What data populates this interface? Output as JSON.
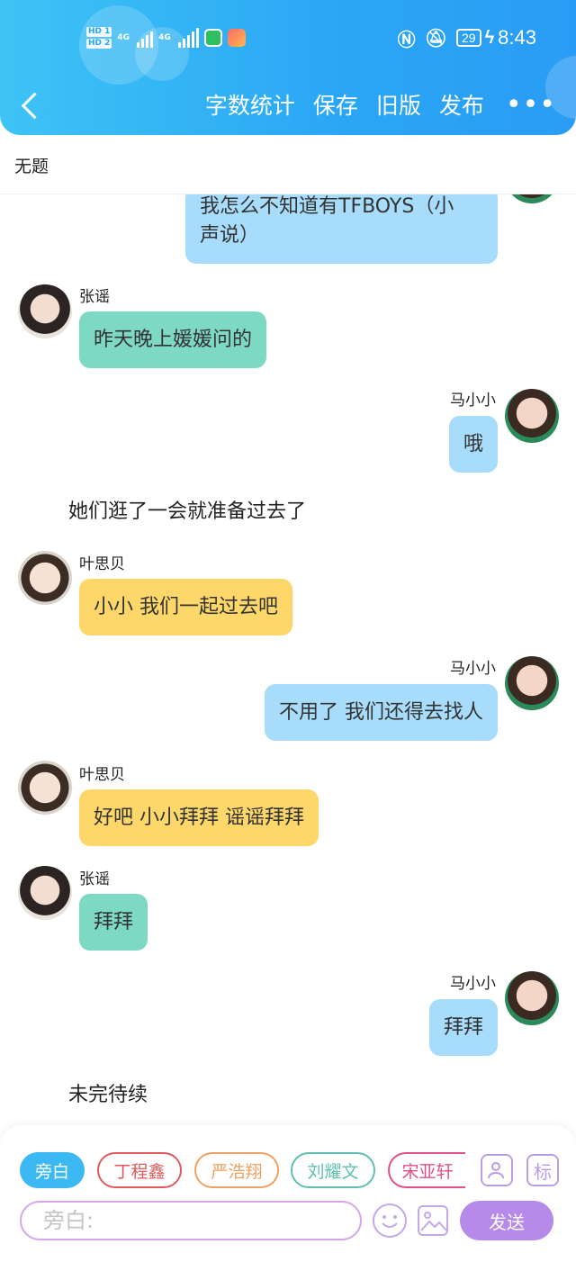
{
  "status_bar": {
    "hd1": "HD 1",
    "hd2": "HD 2",
    "net1": "4G",
    "net2": "4G",
    "battery": "29",
    "time": "8:43",
    "icons": [
      "nfc-icon",
      "mute-bell-icon",
      "charging-bolt-icon"
    ]
  },
  "nav": {
    "back_icon": "chevron-left-icon",
    "word_count": "字数统计",
    "save": "保存",
    "old_version": "旧版",
    "publish": "发布",
    "more": "•••"
  },
  "doc_title": "无题",
  "characters": {
    "zhangyao": {
      "name": "张谣",
      "bubble_color": "#7dd8c4"
    },
    "maxiaoxiao": {
      "name": "马小小",
      "bubble_color": "#a8dcfb"
    },
    "yesibei": {
      "name": "叶思贝",
      "bubble_color": "#fdd76a"
    }
  },
  "messages": [
    {
      "speaker": "马小小",
      "lines": [
        "我怎么不知道有TFBOYS（小",
        "声说）"
      ]
    },
    {
      "speaker": "张谣",
      "text": "昨天晚上媛媛问的"
    },
    {
      "speaker": "马小小",
      "text": "哦"
    },
    {
      "narration": "她们逛了一会就准备过去了"
    },
    {
      "speaker": "叶思贝",
      "text": "小小 我们一起过去吧"
    },
    {
      "speaker": "马小小",
      "text": "不用了 我们还得去找人"
    },
    {
      "speaker": "叶思贝",
      "text": "好吧 小小拜拜 谣谣拜拜"
    },
    {
      "speaker": "张谣",
      "text": "拜拜"
    },
    {
      "speaker": "马小小",
      "text": "拜拜"
    },
    {
      "narration": "未完待续"
    }
  ],
  "composer": {
    "chips": [
      {
        "label": "旁白",
        "color": "#3cb8f2",
        "active": true
      },
      {
        "label": "丁程鑫",
        "color": "#e05a5a"
      },
      {
        "label": "严浩翔",
        "color": "#f0a060"
      },
      {
        "label": "刘耀文",
        "color": "#5fbfb0"
      },
      {
        "label": "宋亚轩",
        "color": "#e0508a"
      }
    ],
    "add_role_icon": "person-add-icon",
    "tag_label": "标",
    "input_placeholder": "旁白:",
    "emoji_icon": "smiley-icon",
    "image_icon": "image-icon",
    "send": "发送"
  }
}
